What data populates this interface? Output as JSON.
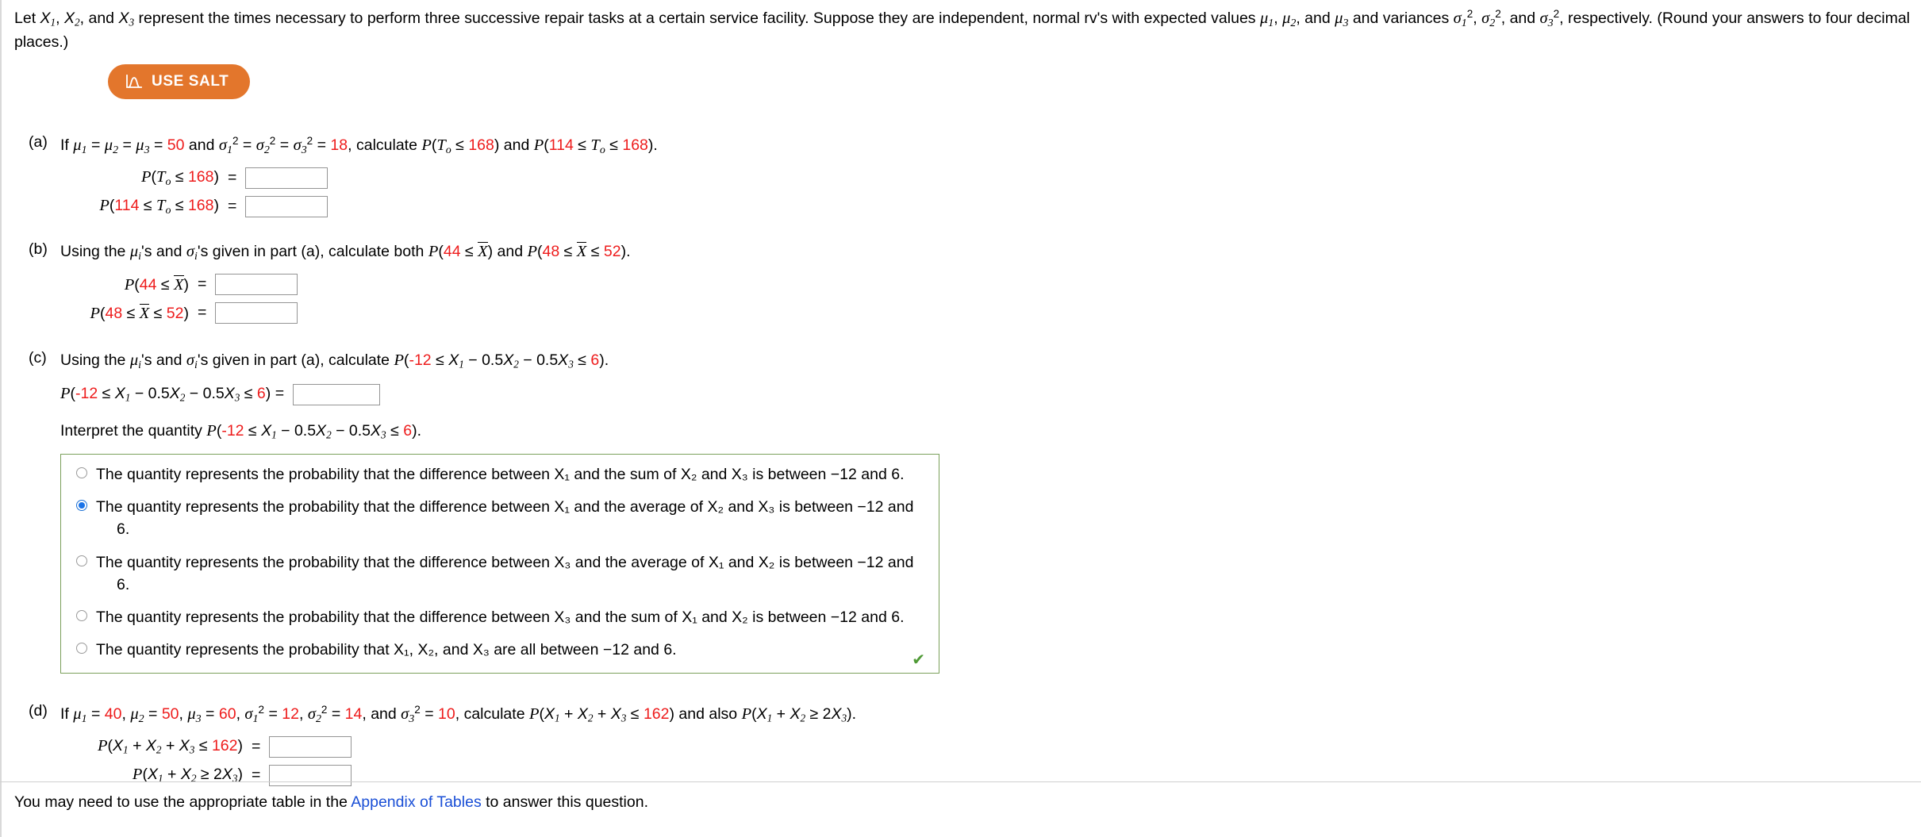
{
  "stem": {
    "text_part1": "Let ",
    "text_part2": " represent the times necessary to perform three successive repair tasks at a certain service facility. Suppose they are independent, normal rv's with expected values ",
    "text_part3": " and variances ",
    "text_part4": ", respectively. (Round your answers to four decimal places.)",
    "vars": [
      "X1",
      "X2",
      "X3"
    ],
    "means": [
      "μ1",
      "μ2",
      "μ3"
    ],
    "variances": [
      "σ1^2",
      "σ2^2",
      "σ3^2"
    ]
  },
  "salt_button": {
    "label": "USE SALT",
    "icon": "normal-curve-icon",
    "bg_color": "#e3762c",
    "text_color": "#ffffff"
  },
  "parts": {
    "a": {
      "label": "(a)",
      "lead": "If",
      "mu_value": "50",
      "sigma_value": "18",
      "calc_word": "calculate",
      "and_word": "and",
      "prob1_bound": "168",
      "prob2_low": "114",
      "prob2_high": "168",
      "answers": [
        {
          "label_bound": "168",
          "value": "",
          "placeholder": ""
        },
        {
          "label_low": "114",
          "label_high": "168",
          "value": "",
          "placeholder": ""
        }
      ]
    },
    "b": {
      "label": "(b)",
      "lead": "Using the",
      "mid": "'s and",
      "mid2": "'s given in part (a), calculate both",
      "and_word": "and",
      "prob1_bound": "44",
      "prob2_low": "48",
      "prob2_high": "52",
      "answers": [
        {
          "label_bound": "44",
          "value": "",
          "placeholder": ""
        },
        {
          "label_low": "48",
          "label_high": "52",
          "value": "",
          "placeholder": ""
        }
      ]
    },
    "c": {
      "label": "(c)",
      "lead": "Using the",
      "mid": "'s and",
      "mid2": "'s given in part (a), calculate",
      "low": "-12",
      "high": "6",
      "coef": "0.5",
      "answer": {
        "value": "",
        "placeholder": ""
      },
      "interpret_lead": "Interpret the quantity",
      "options": [
        {
          "id": "opt-1",
          "selected": false,
          "text": "The quantity represents the probability that the difference between X₁ and the sum of X₂ and X₃ is between −12 and 6."
        },
        {
          "id": "opt-2",
          "selected": true,
          "text": "The quantity represents the probability that the difference between X₁ and the average of X₂ and X₃ is between −12 and",
          "text_cont": "6."
        },
        {
          "id": "opt-3",
          "selected": false,
          "text": "The quantity represents the probability that the difference between X₃ and the average of X₁ and X₂ is between −12 and",
          "text_cont": "6."
        },
        {
          "id": "opt-4",
          "selected": false,
          "text": "The quantity represents the probability that the difference between X₃ and the sum of X₁ and X₂ is between −12 and 6."
        },
        {
          "id": "opt-5",
          "selected": false,
          "text": "The quantity represents the probability that X₁, X₂, and X₃ are all between −12 and 6."
        }
      ],
      "correct_mark": "✔"
    },
    "d": {
      "label": "(d)",
      "lead": "If",
      "mu1": "40",
      "mu2": "50",
      "mu3": "60",
      "sigma1": "12",
      "sigma2": "14",
      "sigma3": "10",
      "calc_word": "calculate",
      "also_word": "and also",
      "sum_bound": "162",
      "answers": [
        {
          "label_bound": "162",
          "value": "",
          "placeholder": ""
        },
        {
          "value": "",
          "placeholder": ""
        }
      ]
    }
  },
  "footer": {
    "text_before": "You may need to use the appropriate table in the ",
    "link_text": "Appendix of Tables",
    "text_after": " to answer this question."
  }
}
